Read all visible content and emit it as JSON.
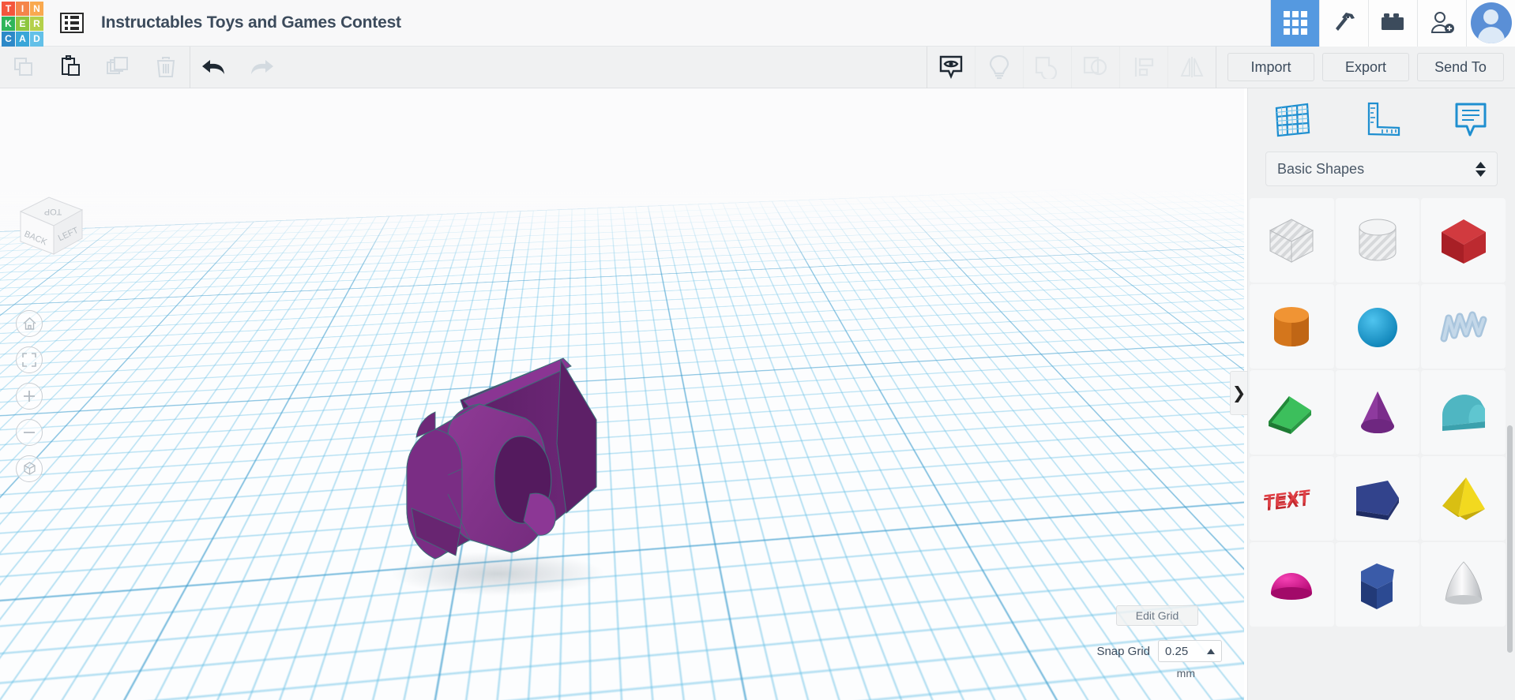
{
  "app": {
    "name": "Tinkercad",
    "logo_letters": [
      "T",
      "I",
      "N",
      "K",
      "E",
      "R",
      "C",
      "A",
      "D"
    ],
    "logo_colors": [
      "#f4563c",
      "#f5854a",
      "#f9a94f",
      "#2fb55a",
      "#8dc63f",
      "#b4d04a",
      "#2d89c8",
      "#3aa6d8",
      "#63c0e8"
    ]
  },
  "header": {
    "project_title": "Instructables Toys and Games Contest",
    "doc_icon": "list-menu-icon",
    "icons": [
      {
        "name": "grid-icon",
        "label": "Designs",
        "active": true
      },
      {
        "name": "pickaxe-icon",
        "label": "Minecraft",
        "active": false
      },
      {
        "name": "lego-brick-icon",
        "label": "Blocks",
        "active": false
      },
      {
        "name": "add-user-icon",
        "label": "Invite",
        "active": false
      }
    ],
    "avatar": "user-avatar"
  },
  "toolbar": {
    "left_tools": [
      {
        "name": "copy-icon",
        "label": "Copy",
        "enabled": false
      },
      {
        "name": "paste-icon",
        "label": "Paste",
        "enabled": true
      },
      {
        "name": "duplicate-icon",
        "label": "Duplicate",
        "enabled": false
      },
      {
        "name": "delete-icon",
        "label": "Delete",
        "enabled": false
      }
    ],
    "history_tools": [
      {
        "name": "undo-icon",
        "label": "Undo",
        "enabled": true
      },
      {
        "name": "redo-icon",
        "label": "Redo",
        "enabled": false
      }
    ],
    "right_tools": [
      {
        "name": "show-hide-icon",
        "label": "Show / Hide",
        "enabled": true
      },
      {
        "name": "lightbulb-icon",
        "label": "Light",
        "enabled": false
      },
      {
        "name": "group-icon",
        "label": "Group",
        "enabled": false
      },
      {
        "name": "ungroup-icon",
        "label": "Ungroup",
        "enabled": false
      },
      {
        "name": "align-icon",
        "label": "Align",
        "enabled": false
      },
      {
        "name": "mirror-icon",
        "label": "Mirror",
        "enabled": false
      }
    ],
    "import_label": "Import",
    "export_label": "Export",
    "send_to_label": "Send To"
  },
  "canvas": {
    "viewcube": {
      "top": "TOP",
      "back": "BACK",
      "left": "LEFT"
    },
    "nav_buttons": [
      {
        "name": "home-view-button",
        "label": "Home view"
      },
      {
        "name": "fit-to-view-button",
        "label": "Fit all in view"
      },
      {
        "name": "zoom-in-button",
        "label": "Zoom in"
      },
      {
        "name": "zoom-out-button",
        "label": "Zoom out"
      },
      {
        "name": "perspective-toggle-button",
        "label": "Switch to orthographic view"
      }
    ],
    "model": {
      "name": "purple-solid-model",
      "color": "#7d2d86"
    },
    "grid_minor_color": "#6ec3e6",
    "grid_major_color": "#3c96c8"
  },
  "grid_controls": {
    "edit_grid_label": "Edit Grid",
    "snap_grid_label": "Snap Grid",
    "snap_grid_value": "0.25",
    "snap_grid_unit": "mm"
  },
  "panel": {
    "collapse_handle": "❯",
    "tabs": [
      {
        "name": "workplane-tab",
        "label": "Workplane",
        "icon": "workplane-grid-icon"
      },
      {
        "name": "ruler-tab",
        "label": "Ruler",
        "icon": "ruler-icon"
      },
      {
        "name": "note-tab",
        "label": "Note",
        "icon": "note-bubble-icon"
      }
    ],
    "category_selected": "Basic Shapes",
    "shapes": [
      {
        "name": "shape-box-hole",
        "label": "Box (hole)",
        "color": "#d8dadc",
        "type": "box",
        "hole": true
      },
      {
        "name": "shape-cylinder-hole",
        "label": "Cylinder (hole)",
        "color": "#d8dadc",
        "type": "cylinder",
        "hole": true
      },
      {
        "name": "shape-box-red",
        "label": "Box",
        "color": "#c1272d",
        "type": "box",
        "hole": false
      },
      {
        "name": "shape-cylinder-orange",
        "label": "Cylinder",
        "color": "#e07b1e",
        "type": "cylinder",
        "hole": false
      },
      {
        "name": "shape-sphere-blue",
        "label": "Sphere",
        "color": "#1b9fd0",
        "type": "sphere",
        "hole": false
      },
      {
        "name": "shape-scribble",
        "label": "Scribble",
        "color": "#a9c5dd",
        "type": "scribble",
        "hole": false
      },
      {
        "name": "shape-roof-green",
        "label": "Roof",
        "color": "#2fa84f",
        "type": "wedge",
        "hole": false
      },
      {
        "name": "shape-cone-purple",
        "label": "Cone",
        "color": "#8e3a9e",
        "type": "cone",
        "hole": false
      },
      {
        "name": "shape-halfcyl-teal",
        "label": "Half Cylinder",
        "color": "#4db8c4",
        "type": "halfcyl",
        "hole": false
      },
      {
        "name": "shape-text-red",
        "label": "Text",
        "color": "#c1272d",
        "type": "text",
        "hole": false
      },
      {
        "name": "shape-polygon-navy",
        "label": "Polygon",
        "color": "#2a3a77",
        "type": "polywedge",
        "hole": false
      },
      {
        "name": "shape-pyramid-yellow",
        "label": "Pyramid",
        "color": "#e8cf1e",
        "type": "pyramid",
        "hole": false
      },
      {
        "name": "shape-hemisphere-pink",
        "label": "Hemisphere",
        "color": "#e0169a",
        "type": "dome",
        "hole": false
      },
      {
        "name": "shape-hexprism-blue",
        "label": "Hexagonal Prism",
        "color": "#2e4a8e",
        "type": "hexprism",
        "hole": false
      },
      {
        "name": "shape-paraboloid-gray",
        "label": "Paraboloid",
        "color": "#d6d8da",
        "type": "paraboloid",
        "hole": false
      }
    ]
  }
}
